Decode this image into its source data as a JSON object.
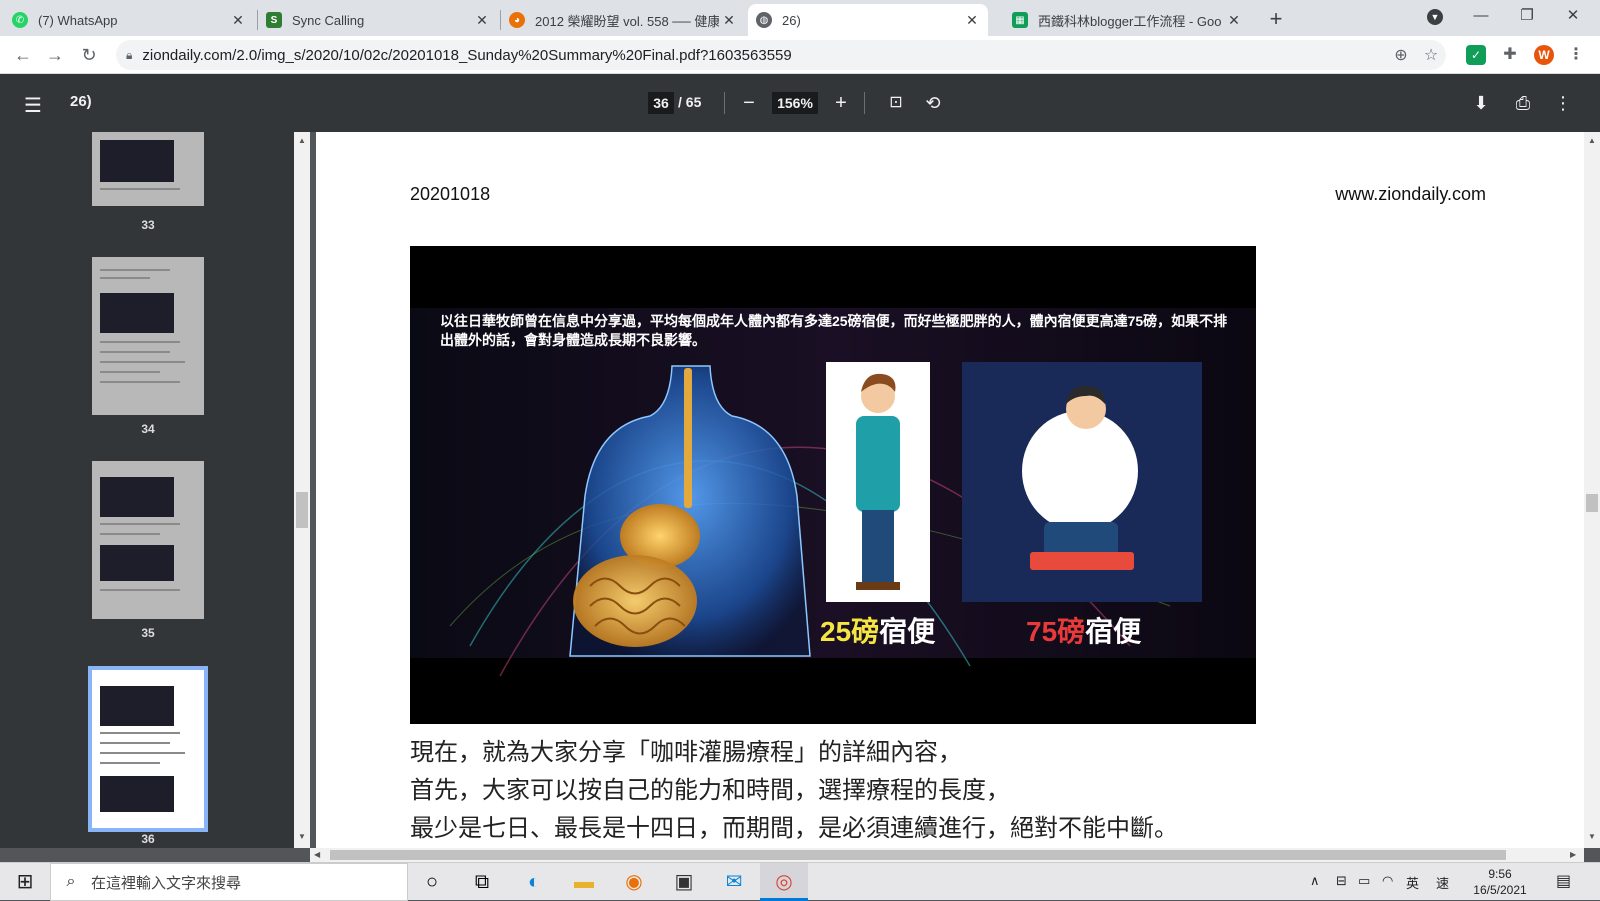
{
  "browser": {
    "tabs": [
      {
        "label": "(7) WhatsApp",
        "favicon": "whatsapp-icon",
        "color": "#25d366"
      },
      {
        "label": "Sync Calling",
        "favicon": "sync-calling-icon",
        "color": "#2e7d32"
      },
      {
        "label": "2012 榮耀盼望 vol. 558 ── 健康",
        "favicon": "palette-icon",
        "color": "#e8710a"
      },
      {
        "label": "26)",
        "favicon": "globe-icon",
        "color": "#5f6368"
      },
      {
        "label": "西鐵科林blogger工作流程 - Goo",
        "favicon": "sheets-icon",
        "color": "#0f9d58"
      }
    ],
    "url": "ziondaily.com/2.0/img_s/2020/10/02c/20201018_Sunday%20Summary%20Final.pdf?1603563559",
    "profile_initial": "W"
  },
  "pdf_viewer": {
    "title": "26)",
    "current_page": "36",
    "page_count": "/ 65",
    "zoom": "156%",
    "thumbnails": [
      {
        "number": "33"
      },
      {
        "number": "34"
      },
      {
        "number": "35"
      },
      {
        "number": "36"
      }
    ]
  },
  "page": {
    "date": "20201018",
    "site": "www.ziondaily.com",
    "figure": {
      "caption": "以往日華牧師曾在信息中分享過，平均每個成年人體內都有多達25磅宿便，而好些極肥胖的人，體內宿便更高達75磅，如果不排出體外的話，會對身體造成長期不良影響。",
      "label_left_number": "25磅",
      "label_left_text": "宿便",
      "label_right_number": "75磅",
      "label_right_text": "宿便"
    },
    "body_lines": [
      "現在，就為大家分享「咖啡灌腸療程」的詳細內容，",
      "首先，大家可以按自己的能力和時間，選擇療程的長度，",
      "最少是七日、最長是十四日，而期間，是必須連續進行，絕對不能中斷。"
    ]
  },
  "taskbar": {
    "search_placeholder": "在這裡輸入文字來搜尋",
    "ime_lang": "英",
    "ime_mode": "速",
    "time": "9:56",
    "date": "16/5/2021"
  }
}
